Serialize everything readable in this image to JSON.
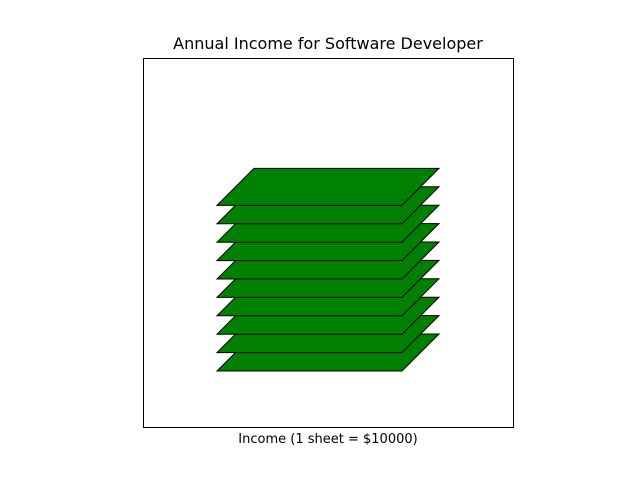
{
  "chart_data": {
    "type": "pictogram",
    "title": "Annual Income for Software Developer",
    "xlabel": "Income (1 sheet = $10000)",
    "ylabel": "",
    "sheet_value": 10000,
    "sheet_count": 10,
    "total_value": 100000,
    "sheet_color": "#008000",
    "edge_color": "#000000",
    "grid": false,
    "ticks": false
  }
}
